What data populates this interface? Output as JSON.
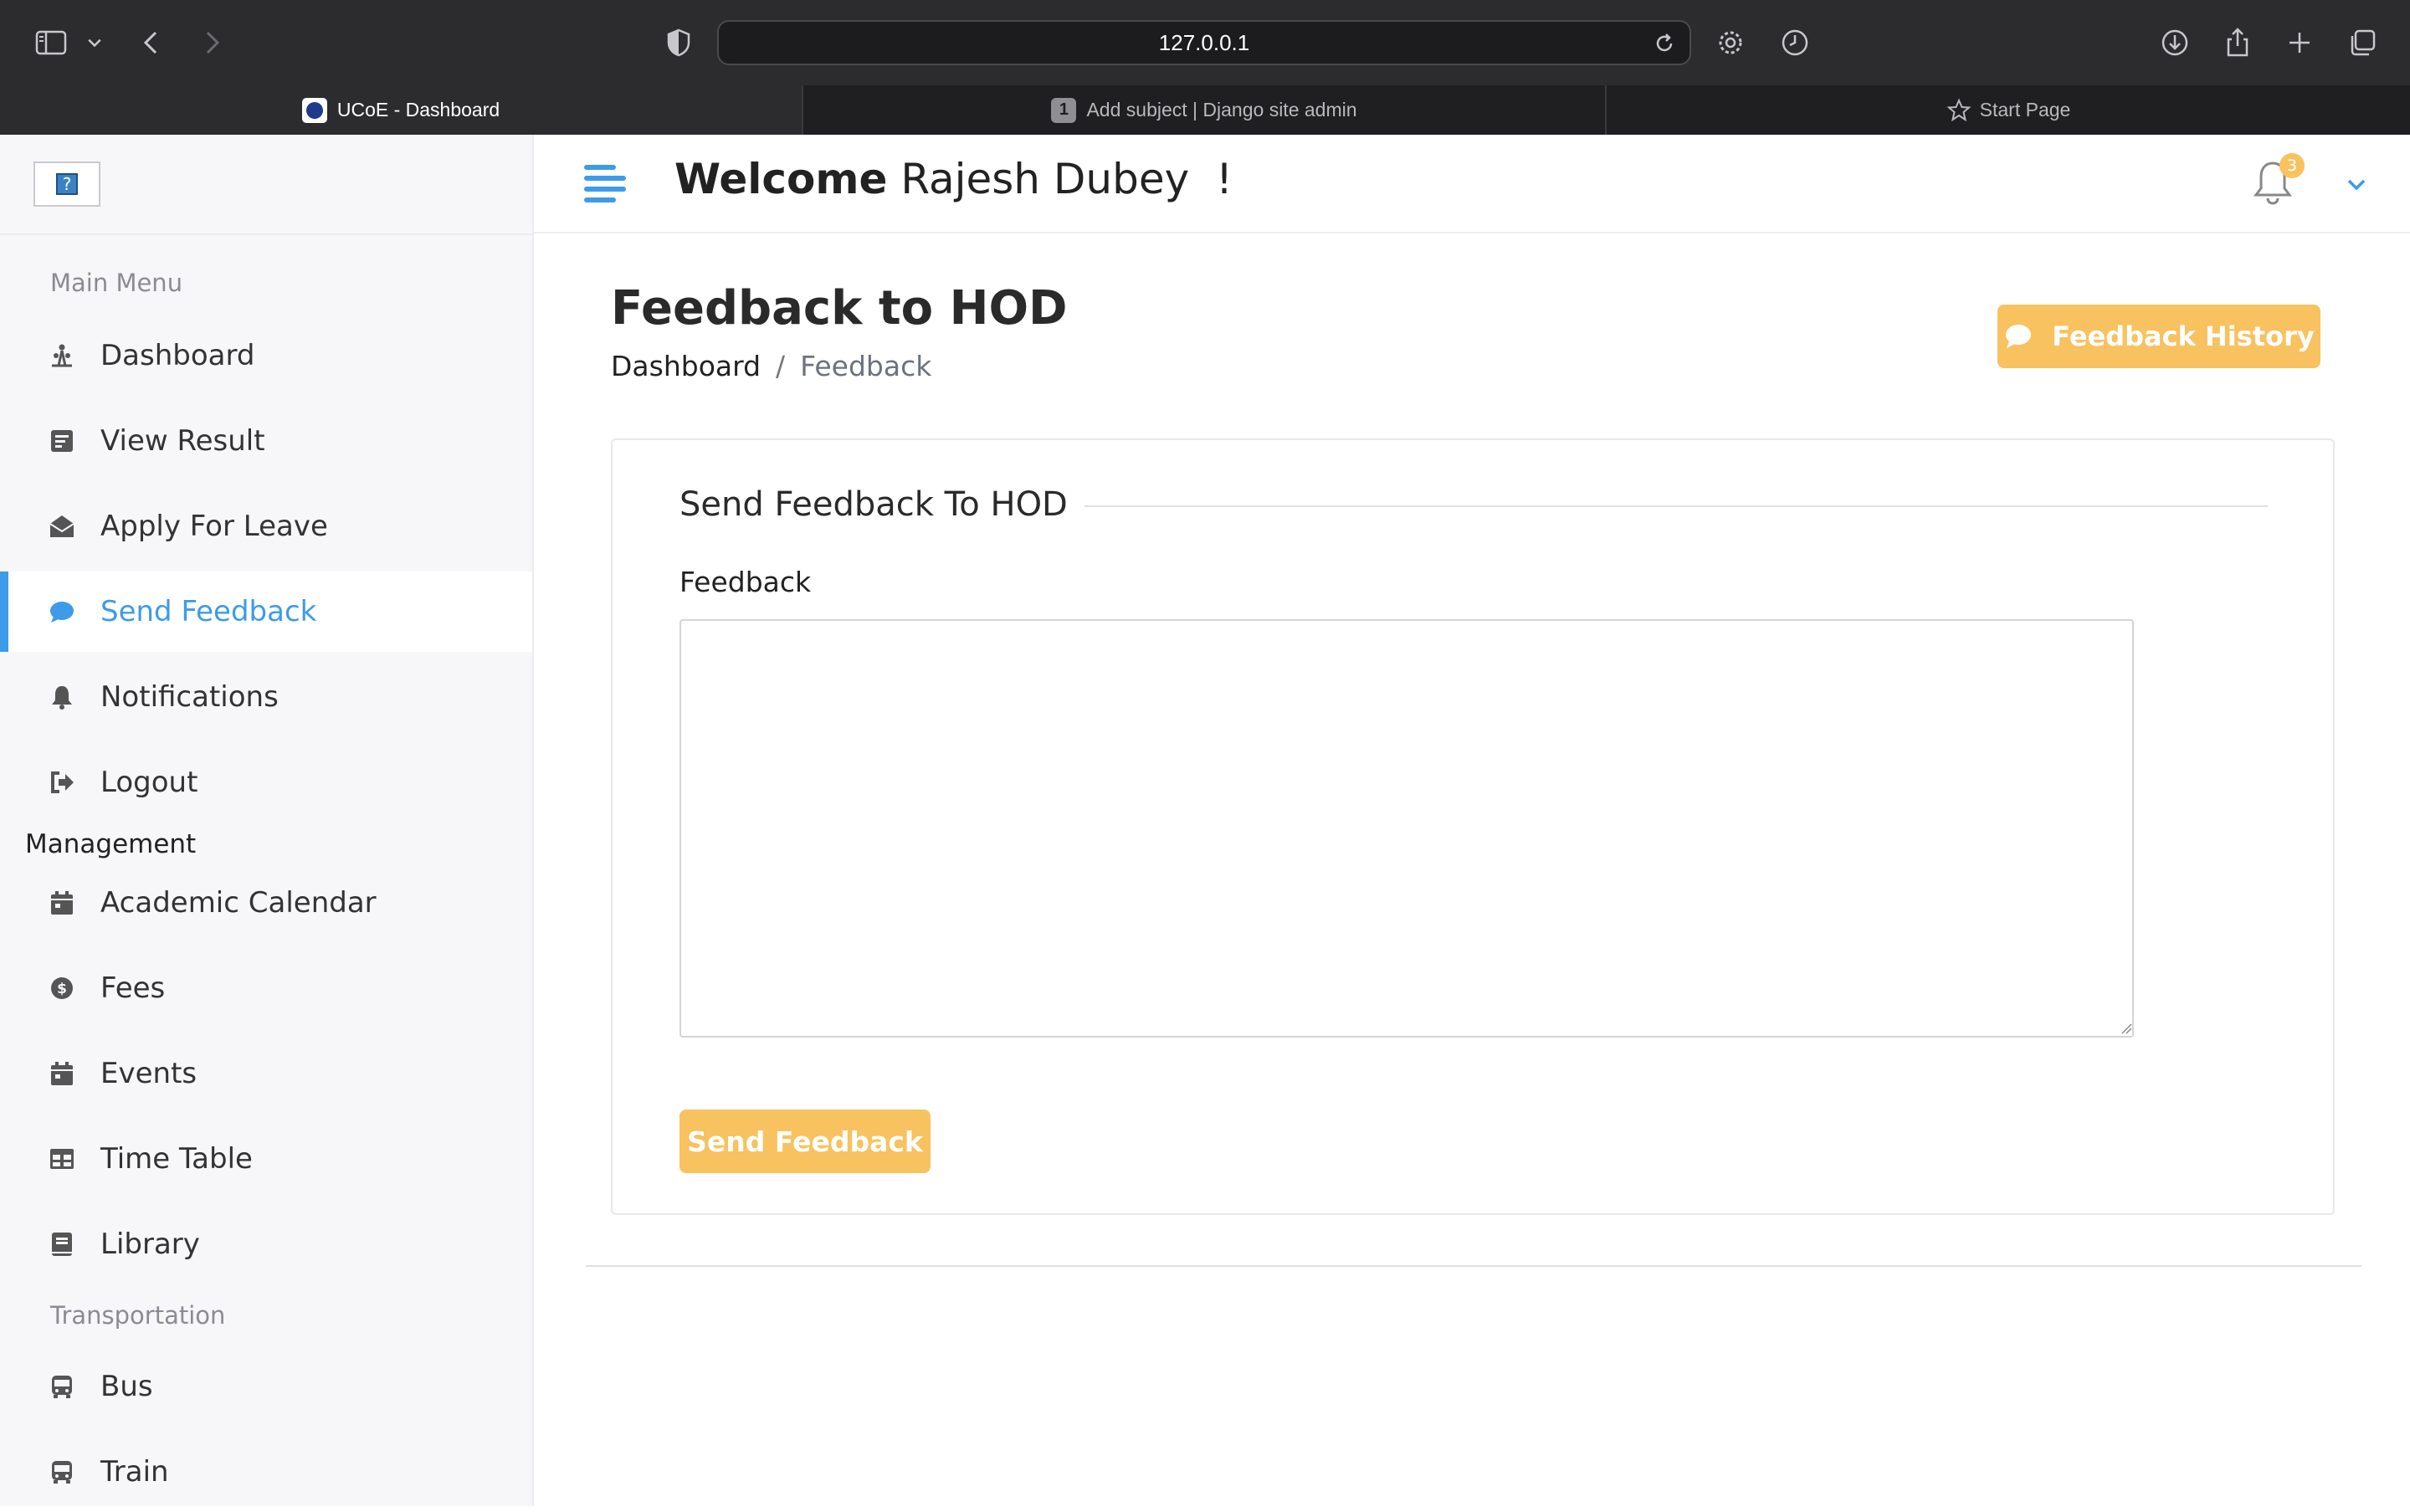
{
  "browser": {
    "url": "127.0.0.1",
    "tabs": [
      {
        "label": "UCoE - Dashboard",
        "active": true
      },
      {
        "label": "Add subject | Django site admin",
        "number": "1"
      },
      {
        "label": "Start Page"
      }
    ]
  },
  "sidebar": {
    "logo_glyph": "?",
    "main_menu_title": "Main Menu",
    "main_items": [
      {
        "label": "Dashboard",
        "icon": "dashboard-icon"
      },
      {
        "label": "View Result",
        "icon": "result-icon"
      },
      {
        "label": "Apply For Leave",
        "icon": "envelope-open-icon"
      },
      {
        "label": "Send Feedback",
        "icon": "comment-icon",
        "active": true
      },
      {
        "label": "Notifications",
        "icon": "bell-icon"
      },
      {
        "label": "Logout",
        "icon": "logout-icon"
      }
    ],
    "management_title": "Management",
    "management_items": [
      {
        "label": "Academic Calendar",
        "icon": "calendar-icon"
      },
      {
        "label": "Fees",
        "icon": "money-icon"
      },
      {
        "label": "Events",
        "icon": "calendar-icon"
      },
      {
        "label": "Time Table",
        "icon": "table-icon"
      },
      {
        "label": "Library",
        "icon": "book-icon"
      }
    ],
    "transport_title": "Transportation",
    "transport_items": [
      {
        "label": "Bus",
        "icon": "bus-icon"
      },
      {
        "label": "Train",
        "icon": "train-icon"
      }
    ]
  },
  "header": {
    "welcome_bold": "Welcome",
    "user_name": " Rajesh Dubey  !",
    "notification_count": "3"
  },
  "main": {
    "title": "Feedback to HOD",
    "breadcrumb_home": "Dashboard",
    "breadcrumb_sep": "/",
    "breadcrumb_current": "Feedback",
    "history_button": "Feedback History",
    "card_title": "Send Feedback To HOD",
    "field_label": "Feedback",
    "field_value": "",
    "submit_button": "Send Feedback"
  },
  "colors": {
    "accent": "#3d9be9",
    "warning": "#f7c25f",
    "chrome_bg": "#2c2c2e"
  }
}
